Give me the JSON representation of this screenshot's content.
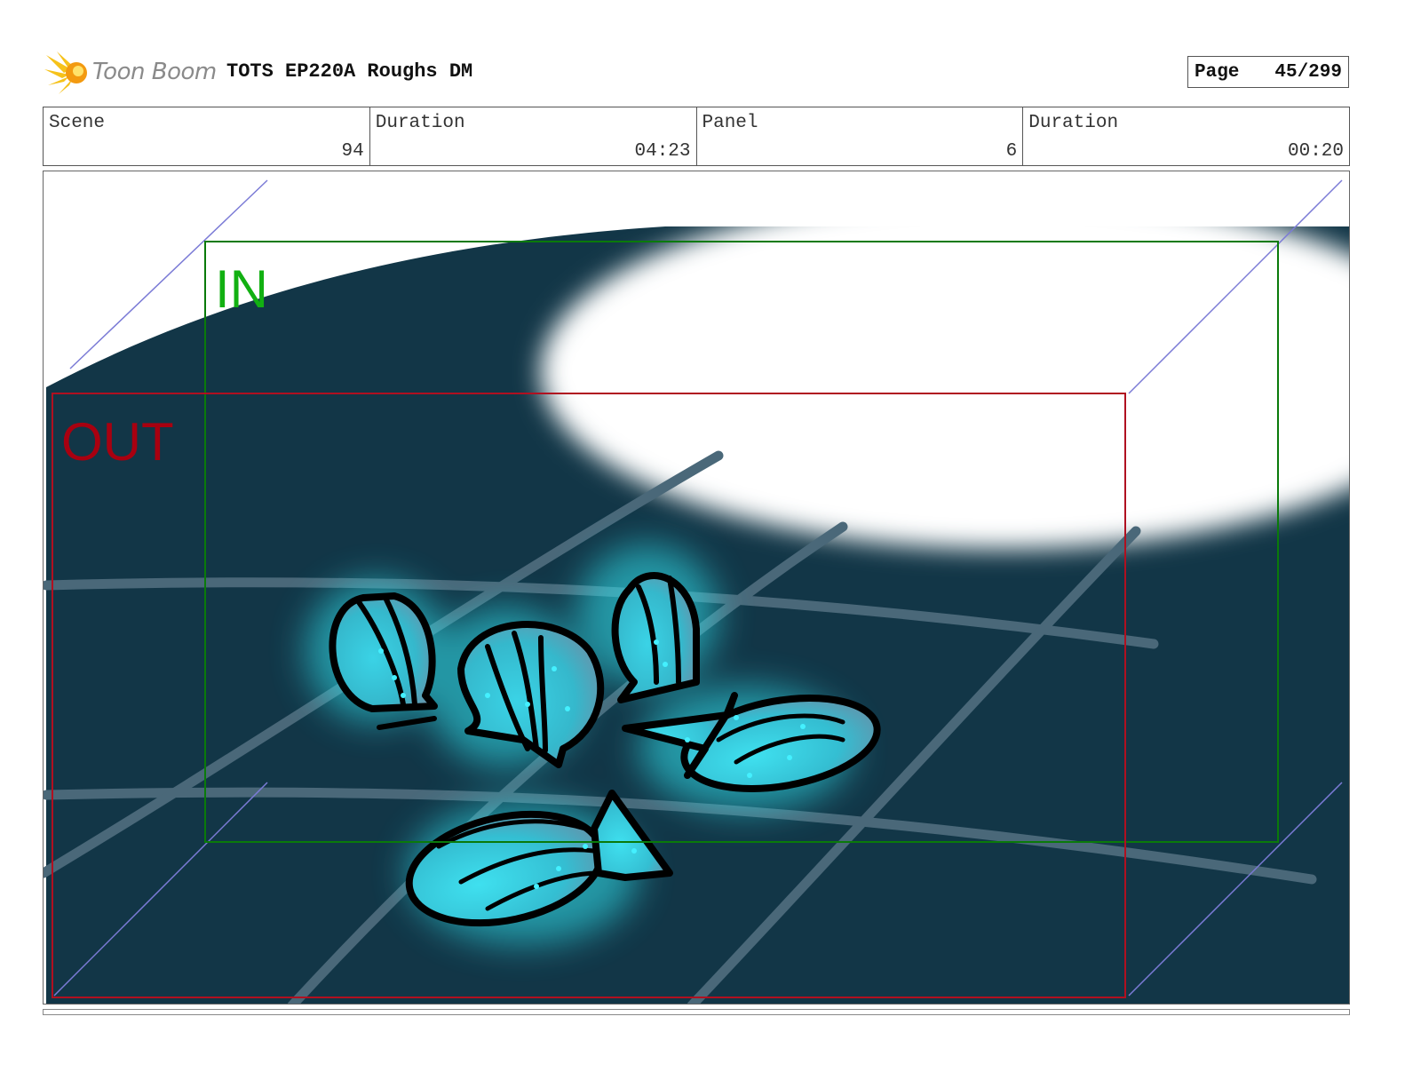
{
  "header": {
    "logo_text": "Toon Boom",
    "title": "TOTS EP220A Roughs DM",
    "page_label": "Page",
    "page_value": "45/299"
  },
  "info": [
    {
      "label": "Scene",
      "value": "94"
    },
    {
      "label": "Duration",
      "value": "04:23"
    },
    {
      "label": "Panel",
      "value": "6"
    },
    {
      "label": "Duration",
      "value": "00:20"
    }
  ],
  "panel": {
    "in_label": "IN",
    "out_label": "OUT",
    "colors": {
      "water": "#123647",
      "glow": "#33e6f2",
      "in_frame": "#0a7a0a",
      "out_frame": "#b01020",
      "camera_guides": "#7b7bd6"
    },
    "icons": [
      "toon-boom-logo-icon",
      "shell-icon",
      "fish-icon"
    ]
  }
}
